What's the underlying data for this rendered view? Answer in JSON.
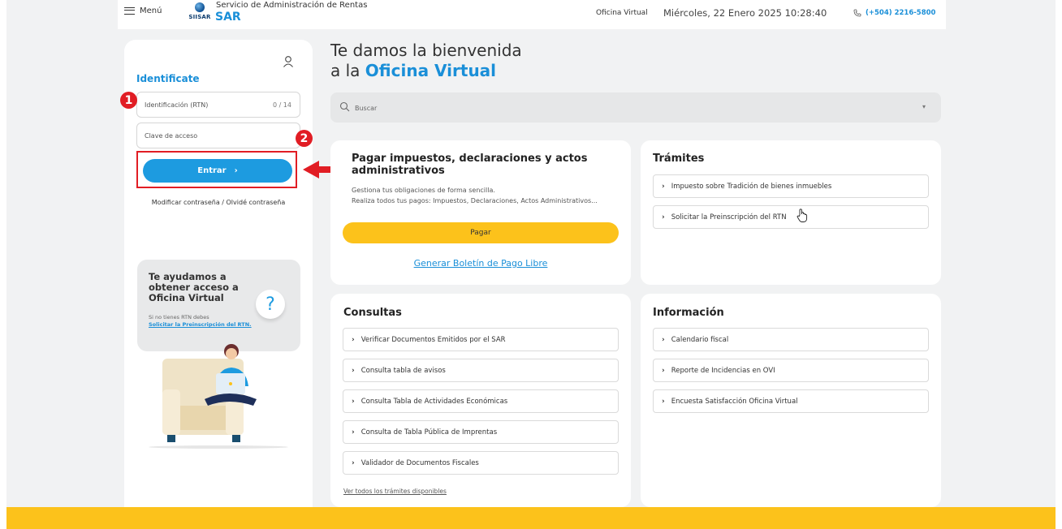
{
  "header": {
    "menu_label": "Menú",
    "logo_text": "SIISAR",
    "org_name": "Servicio de Administración de Rentas",
    "org_abbr": "SAR",
    "office_label": "Oficina Virtual",
    "datetime": "Miércoles, 22 Enero 2025 10:28:40",
    "phone": "(+504) 2216-5800"
  },
  "login": {
    "title": "Identificate",
    "rtn_placeholder": "Identificación (RTN)",
    "rtn_count": "0 / 14",
    "password_placeholder": "Clave de acceso",
    "submit_label": "Entrar",
    "modify_link": "Modificar contraseña / Olvidé contraseña",
    "step_badges": [
      "1",
      "2"
    ]
  },
  "help": {
    "title": "Te ayudamos a obtener acceso a Oficina Virtual",
    "subtitle": "Si no tienes RTN debes",
    "link": "Solicitar la Preinscripción del RTN.",
    "icon_glyph": "?"
  },
  "welcome": {
    "line1": "Te damos la bienvenida",
    "line2_prefix": "a la ",
    "line2_highlight": "Oficina Virtual"
  },
  "search": {
    "placeholder": "Buscar"
  },
  "pagar": {
    "title": "Pagar impuestos, declaraciones y actos administrativos",
    "desc1": "Gestiona tus obligaciones de forma sencilla.",
    "desc2": "Realiza todos tus pagos: Impuestos, Declaraciones, Actos Administrativos...",
    "button": "Pagar",
    "boletin_link": "Generar Boletín de Pago Libre"
  },
  "tramites": {
    "title": "Trámites",
    "items": [
      "Impuesto sobre Tradición de bienes inmuebles",
      "Solicitar la Preinscripción del RTN"
    ]
  },
  "consultas": {
    "title": "Consultas",
    "items": [
      "Verificar Documentos Emitidos por el SAR",
      "Consulta tabla de avisos",
      "Consulta Tabla de Actividades Económicas",
      "Consulta de Tabla Pública de Imprentas",
      "Validador de Documentos Fiscales"
    ],
    "see_all": "Ver todos los trámites disponibles"
  },
  "informacion": {
    "title": "Información",
    "items": [
      "Calendario fiscal",
      "Reporte de Incidencias en OVI",
      "Encuesta Satisfacción Oficina Virtual"
    ]
  },
  "colors": {
    "accent_blue": "#1a8fd8",
    "button_blue": "#1d9be0",
    "yellow": "#fcc21b",
    "annotation_red": "#e11d24",
    "background": "#f1f2f3"
  }
}
